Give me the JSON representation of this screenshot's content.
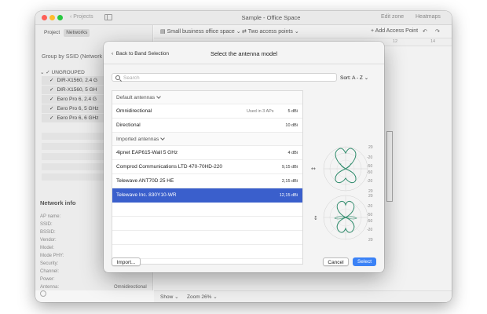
{
  "window": {
    "title": "Sample - Office Space",
    "back_label": "Projects",
    "edit_zone_label": "Edit zone",
    "heatmaps_label": "Heatmaps"
  },
  "sidebar": {
    "tabs": [
      "Project",
      "Networks"
    ],
    "active_tab": "Networks",
    "group_by": "Group by SSID (Network na",
    "group_label": "UNGROUPED",
    "access_points": [
      {
        "name": "DIR-X1560, 2.4 G",
        "checked": true
      },
      {
        "name": "DIR-X1560, 5 GH",
        "checked": true
      },
      {
        "name": "Eero Pro 6, 2.4 G",
        "checked": true
      },
      {
        "name": "Eero Pro 6, 5 GHz",
        "checked": true
      },
      {
        "name": "Eero Pro 6, 6 GHz",
        "checked": true
      }
    ],
    "network_info": {
      "title": "Network info",
      "fields": [
        "AP name:",
        "SSID:",
        "BSSID:",
        "Vendor:",
        "Model:",
        "Mode PHY:",
        "Security:",
        "Channel:",
        "Power:",
        "Antenna:"
      ],
      "antenna_value": "Omnidirectional"
    }
  },
  "main_toolbar": {
    "floor_select": "Small business office space",
    "access_points_select": "Two access points",
    "add_ap_label": "Add Access Point",
    "ruler_ticks": [
      "12",
      "14"
    ]
  },
  "bottom_bar": {
    "show_label": "Show",
    "zoom_label": "Zoom 26%"
  },
  "modal": {
    "back_label": "Back to Band Selection",
    "title": "Select the antenna model",
    "search_placeholder": "Search",
    "sort_label": "Sort: A - Z",
    "sections": {
      "default_label": "Default antennas",
      "imported_label": "Imported antennas"
    },
    "default_antennas": [
      {
        "name": "Omnidirectional",
        "used": "Used in 3 APs",
        "gain": "5 dBi"
      },
      {
        "name": "Directional",
        "used": "",
        "gain": "10 dBi"
      }
    ],
    "imported_antennas": [
      {
        "name": "4ipnet EAP615-Wall 5 GHz",
        "gain": "4 dBi"
      },
      {
        "name": "Comprod Communications LTD 470-70HD-220",
        "gain": "9,15 dBi"
      },
      {
        "name": "Telewave ANT70D 25 HE",
        "gain": "2,15 dBi"
      },
      {
        "name": "Telewave Inc. 830Y10-WR",
        "gain": "12,15 dBi",
        "selected": true
      }
    ],
    "pattern_axis_labels": [
      "20",
      "-20",
      "-50",
      "-50",
      "-20",
      "20"
    ],
    "pattern_axis_labels_bottom": [
      "20",
      "-20",
      "-50",
      "-50",
      "-20",
      "20"
    ],
    "buttons": {
      "import": "Import...",
      "cancel": "Cancel",
      "select": "Select"
    },
    "colors": {
      "selected_row": "#3a5fcc",
      "primary_button": "#3b82f6",
      "pattern_line": "#2e8b6b"
    }
  }
}
